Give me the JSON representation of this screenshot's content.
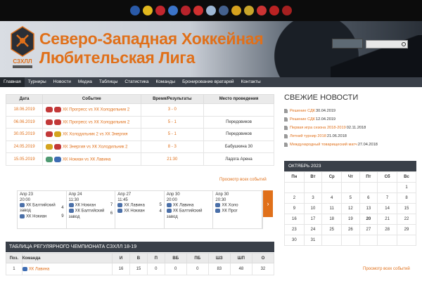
{
  "topbar": {
    "logos": [
      {
        "name": "team-logo-1",
        "color": "#2a5aa8"
      },
      {
        "name": "team-logo-2",
        "color": "#e2b81e"
      },
      {
        "name": "team-logo-3",
        "color": "#c2262e"
      },
      {
        "name": "team-logo-4",
        "color": "#3b74c9"
      },
      {
        "name": "team-logo-5",
        "color": "#b8232b"
      },
      {
        "name": "team-logo-6",
        "color": "#d03030"
      },
      {
        "name": "team-logo-7",
        "color": "#9db7d4"
      },
      {
        "name": "team-logo-8",
        "color": "#44618e"
      },
      {
        "name": "team-logo-9",
        "color": "#d6a21e"
      },
      {
        "name": "team-logo-10",
        "color": "#c8a52a"
      },
      {
        "name": "team-logo-11",
        "color": "#cc3333"
      },
      {
        "name": "team-logo-12",
        "color": "#bb2222"
      },
      {
        "name": "team-logo-13",
        "color": "#a62020"
      }
    ]
  },
  "banner": {
    "title": "Северо-Западная Хоккейная Любительская Лига",
    "logo_text": "СЗХЛЛ",
    "accent": "#e0701a"
  },
  "nav": {
    "items": [
      "Главная",
      "Турниры",
      "Новости",
      "Медиа",
      "Таблицы",
      "Статистика",
      "Команды",
      "Бронирование вратарей",
      "Контакты"
    ]
  },
  "events": {
    "headers": [
      "Дата",
      "Событие",
      "Время/Результаты",
      "Место проведения"
    ],
    "rows": [
      {
        "date": "18.06.2019",
        "event": "ХК Прогресс vs ХК Холодильник 2",
        "result": "3 - 0",
        "place": "",
        "icons": [
          "#c23838",
          "#c23838"
        ]
      },
      {
        "date": "06.06.2019",
        "event": "ХК Прогресс vs ХК Холодильник 2",
        "result": "5 - 1",
        "place": "Передовиков",
        "icons": [
          "#c23838",
          "#c23838"
        ]
      },
      {
        "date": "30.05.2019",
        "event": "ХК Холодильник 2 vs ХК Энергия",
        "result": "5 - 1",
        "place": "Передовиков",
        "icons": [
          "#c23838",
          "#d4a41e"
        ]
      },
      {
        "date": "24.05.2019",
        "event": "ХК Энергия vs ХК Холодильник 2",
        "result": "8 - 3",
        "place": "Бабушкина 30",
        "icons": [
          "#d4a41e",
          "#c23838"
        ]
      },
      {
        "date": "15.05.2019",
        "event": "ХК Нокиан vs ХК Лавина",
        "result": "21:30",
        "place": "Ладога Арена",
        "icons": [
          "#4f9a72",
          "#3d6cb3"
        ]
      }
    ],
    "all_link": "Просмотр всех событий"
  },
  "games": [
    {
      "date": "Апр 23",
      "time": "20:00",
      "team1": "ХК Балтийский завод",
      "score1": "4",
      "team2": "ХК Нокиан",
      "score2": "9"
    },
    {
      "date": "Апр 24",
      "time": "11:30",
      "team1": "ХК Нокиан",
      "score1": "7",
      "team2": "ХК Балтийский завод",
      "score2": "6"
    },
    {
      "date": "Апр 27",
      "time": "11:45",
      "team1": "ХК Лавина",
      "score1": "5",
      "team2": "ХК Нокиан",
      "score2": "4"
    },
    {
      "date": "Апр 30",
      "time": "20:00",
      "team1": "ХК Лавина",
      "score1": "",
      "team2": "ХК Балтийский завод",
      "score2": ""
    },
    {
      "date": "Апр 30",
      "time": "20:30",
      "team1": "ХК Холо",
      "score1": "",
      "team2": "ХК Прог",
      "score2": ""
    }
  ],
  "standings": {
    "title": "ТАБЛИЦА РЕГУЛЯРНОГО ЧЕМПИОНАТА СЗХЛЛ 18-19",
    "headers": [
      "Поз.",
      "Команда",
      "И",
      "В",
      "П",
      "ВБ",
      "ПБ",
      "ШЗ",
      "ШП",
      "О"
    ],
    "rows": [
      {
        "pos": "1",
        "team": "ХК Лавина",
        "g": "16",
        "w": "15",
        "l": "0",
        "wo": "0",
        "lo": "0",
        "gf": "83",
        "ga": "48",
        "pts": "32"
      }
    ]
  },
  "news": {
    "heading": "СВЕЖИЕ НОВОСТИ",
    "items": [
      {
        "title": "Решение СДК",
        "date": "30.04.2019"
      },
      {
        "title": "Решение СДК",
        "date": "12.04.2019"
      },
      {
        "title": "Первая игра сезона 2018-2019",
        "date": "02.11.2018"
      },
      {
        "title": "Летний турнир 2018",
        "date": "21.06.2018"
      },
      {
        "title": "Международный товарищеский матч",
        "date": "27.04.2018"
      }
    ],
    "all_link": "Просмотр всех событий"
  },
  "calendar": {
    "month": "ОКТЯБРЬ 2023",
    "days": [
      "Пн",
      "Вт",
      "Ср",
      "Чт",
      "Пт",
      "Сб",
      "Вс"
    ],
    "weeks": [
      [
        "",
        "",
        "",
        "",
        "",
        "",
        "1"
      ],
      [
        "2",
        "3",
        "4",
        "5",
        "6",
        "7",
        "8"
      ],
      [
        "9",
        "10",
        "11",
        "12",
        "13",
        "14",
        "15"
      ],
      [
        "16",
        "17",
        "18",
        "19",
        "20",
        "21",
        "22"
      ],
      [
        "23",
        "24",
        "25",
        "26",
        "27",
        "28",
        "29"
      ],
      [
        "30",
        "31",
        "",
        "",
        "",
        "",
        ""
      ]
    ],
    "today": "20"
  }
}
